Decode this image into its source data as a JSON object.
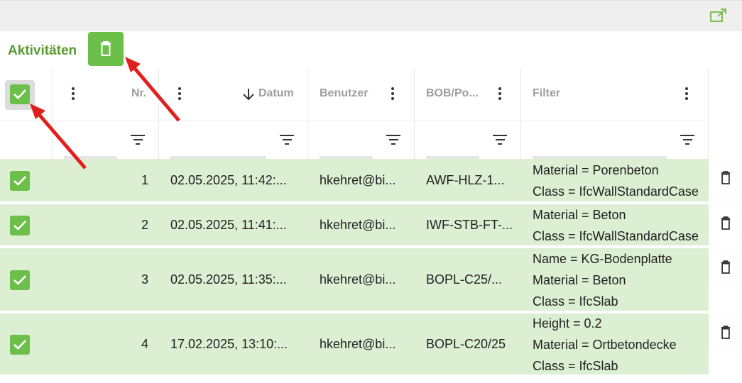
{
  "panel": {
    "title": "Aktivitäten"
  },
  "columns": {
    "nr": "Nr.",
    "datum": "Datum",
    "benutzer": "Benutzer",
    "bob": "BOB/Po...",
    "filter": "Filter"
  },
  "rows": [
    {
      "nr": "1",
      "datum": "02.05.2025, 11:42:...",
      "benutzer": "hkehret@bi...",
      "bob": "AWF-HLZ-1...",
      "filter": [
        "Material = Porenbeton",
        "Class = IfcWallStandardCase"
      ],
      "checked": true
    },
    {
      "nr": "2",
      "datum": "02.05.2025, 11:41:...",
      "benutzer": "hkehret@bi...",
      "bob": "IWF-STB-FT-...",
      "filter": [
        "Material = Beton",
        "Class = IfcWallStandardCase"
      ],
      "checked": true
    },
    {
      "nr": "3",
      "datum": "02.05.2025, 11:35:...",
      "benutzer": "hkehret@bi...",
      "bob": "BOPL-C25/...",
      "filter": [
        "Name = KG-Bodenplatte",
        "Material = Beton",
        "Class = IfcSlab"
      ],
      "checked": true
    },
    {
      "nr": "4",
      "datum": "17.02.2025, 13:10:...",
      "benutzer": "hkehret@bi...",
      "bob": "BOPL-C20/25",
      "filter": [
        "Height = 0.2",
        "Material = Ortbetondecke",
        "Class = IfcSlab"
      ],
      "checked": true
    }
  ],
  "colors": {
    "accent": "#6cc04a",
    "title": "#5a9a32",
    "rowSelected": "#dcefd2",
    "arrow": "#e0201e"
  },
  "icons": {
    "external": "external-link-icon",
    "trash": "trash-icon",
    "check": "check-icon",
    "sortDown": "arrow-down-icon",
    "menu": "kebab-menu-icon",
    "filter": "filter-icon"
  }
}
